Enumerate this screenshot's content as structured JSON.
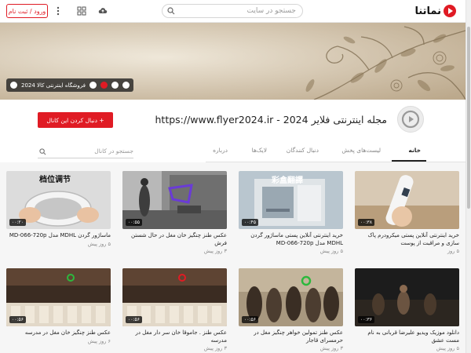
{
  "header": {
    "logo_text": "نماتنا",
    "search_placeholder": "جستجو در سایت",
    "login_label": "ورود / ثبت نام",
    "icons": [
      "search-icon",
      "upload-icon",
      "apps-grid-icon",
      "more-vert-icon"
    ]
  },
  "banner": {
    "social_text": "فروشگاه اینترنتی کالا 2024"
  },
  "channel": {
    "title": "مجله اینترنتی فلایر 2024 - https://www.flyer2024.ir",
    "follow_label": "+ دنبال کردن این کانال",
    "tabs": [
      "خانه",
      "لیست‌های پخش",
      "دنبال کنندگان",
      "لایک‌ها",
      "درباره"
    ],
    "active_tab": "خانه",
    "search_placeholder": "جستجو در کانال"
  },
  "videos": [
    {
      "title": "خرید اینترنتی آنلاین پستی میکرودرم پاک سازی و مراقبت از پوست",
      "meta": "۵ روز",
      "duration": "۰۰:۳۸"
    },
    {
      "title": "خرید اینترنتی آنلاین پستی ماساژور گردن MDHL مدل MD-066-720p",
      "meta": "۵ روز پیش",
      "duration": "۰۰:۴۵"
    },
    {
      "title": "عکس طنز چنگیز خان مغل در حال شستن فرش",
      "meta": "۳ روز پیش",
      "duration": "۰۰:۵۵"
    },
    {
      "title": "ماساژور گردن MDHL مدل MD-066-720p",
      "meta": "۵ روز پیش",
      "duration": "۰۰:۲۰"
    },
    {
      "title": "دانلود موزیک ویدیو علیرضا قربانی به نام مست عشق",
      "meta": "۵ روز پیش",
      "duration": "۰۰:۳۶"
    },
    {
      "title": "عکس طنز تمولین خواهر چنگیز مغل در حرمسرای قاجار",
      "meta": "۳ روز پیش",
      "duration": "۰۰:۵۶"
    },
    {
      "title": "عکس طنز . جاموقا خان سر دار مغل در مدرسه",
      "meta": "۳ روز پیش",
      "duration": "۰۰:۵۶"
    },
    {
      "title": "عکس طنز چنگیز خان مغل در مدرسه",
      "meta": "۶ روز پیش",
      "duration": "۰۰:۵۶"
    }
  ],
  "thumb_text": {
    "v1_cn": "档位调节",
    "v3_cn": "彩盒翻譯"
  },
  "colors": {
    "accent": "#e01b24",
    "text": "#222222",
    "muted": "#888888"
  }
}
